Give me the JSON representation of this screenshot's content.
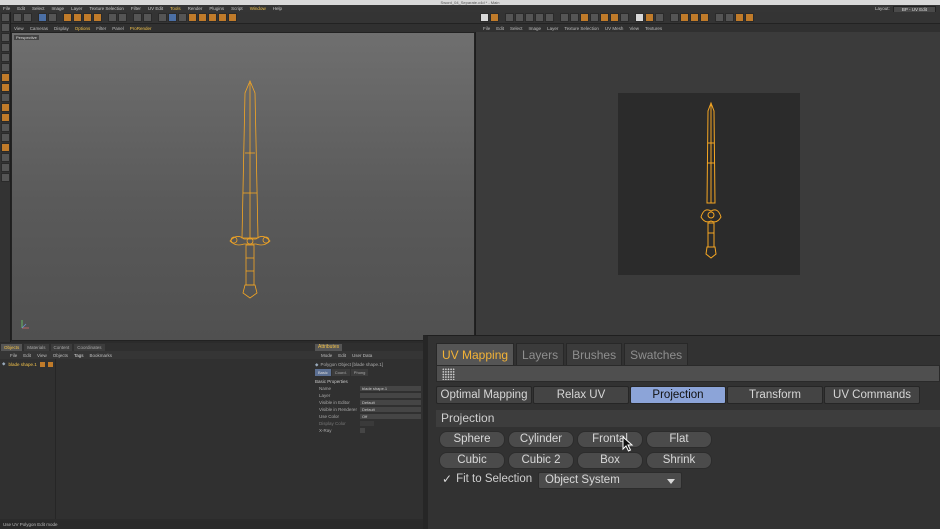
{
  "window": {
    "title": "Sword_04_Separate.c4d * - Main"
  },
  "main_menu": [
    "File",
    "Edit",
    "Select",
    "Image",
    "Layer",
    "Texture Selection",
    "Filter",
    "UV Edit",
    "Tools",
    "Render",
    "Plugins",
    "Script",
    "Window",
    "Help"
  ],
  "layout": {
    "label": "Layout:",
    "value": "BP - UV Edit"
  },
  "viewport_left": {
    "menu": [
      "View",
      "Cameras",
      "Display",
      "Options",
      "Filter",
      "Panel",
      "ProRender"
    ],
    "label": "Perspective"
  },
  "viewport_right": {
    "menu": [
      "File",
      "Edit",
      "Select",
      "Image",
      "Layer",
      "Texture Selection",
      "UV Mesh",
      "View",
      "Textures"
    ]
  },
  "objects_panel": {
    "tabs": [
      "Objects",
      "Materials",
      "Content",
      "Coordinates"
    ],
    "menu": [
      "File",
      "Edit",
      "View",
      "Objects",
      "Tags",
      "Bookmarks"
    ],
    "object_name": "blade shape.1"
  },
  "attributes_panel": {
    "tab": "Attributes",
    "menu": [
      "Mode",
      "Edit",
      "User Data"
    ],
    "header": "Polygon Object [blade shape.1]",
    "subtabs": [
      "Basic",
      "Coord.",
      "Phong"
    ],
    "section": "Basic Properties",
    "rows": [
      {
        "label": "Name",
        "value": "blade shape.1"
      },
      {
        "label": "Layer",
        "value": ""
      },
      {
        "label": "Visible in Editor",
        "value": "Default"
      },
      {
        "label": "Visible in Renderer",
        "value": "Default"
      },
      {
        "label": "Use Color",
        "value": "Off"
      },
      {
        "label": "Display Color",
        "value": ""
      },
      {
        "label": "X-Ray",
        "value": ""
      }
    ]
  },
  "status_bar": {
    "text": "Use UV Polygon Edit mode"
  },
  "uv_manager": {
    "tabs": [
      "UV Mapping",
      "Layers",
      "Brushes",
      "Swatches"
    ],
    "active_tab": "UV Mapping",
    "subtabs": [
      "Optimal Mapping",
      "Relax UV",
      "Projection",
      "Transform",
      "UV Commands"
    ],
    "active_subtab": "Projection",
    "section_title": "Projection",
    "buttons_row1": [
      "Sphere",
      "Cylinder",
      "Frontal",
      "Flat"
    ],
    "buttons_row2": [
      "Cubic",
      "Cubic 2",
      "Box",
      "Shrink"
    ],
    "fit_label": "Fit to Selection",
    "fit_checked": true,
    "coordinate_system": "Object System"
  },
  "colors": {
    "accent": "#f3b337",
    "active_subtab": "#8ca4d8",
    "wireframe": "#f5a623"
  }
}
